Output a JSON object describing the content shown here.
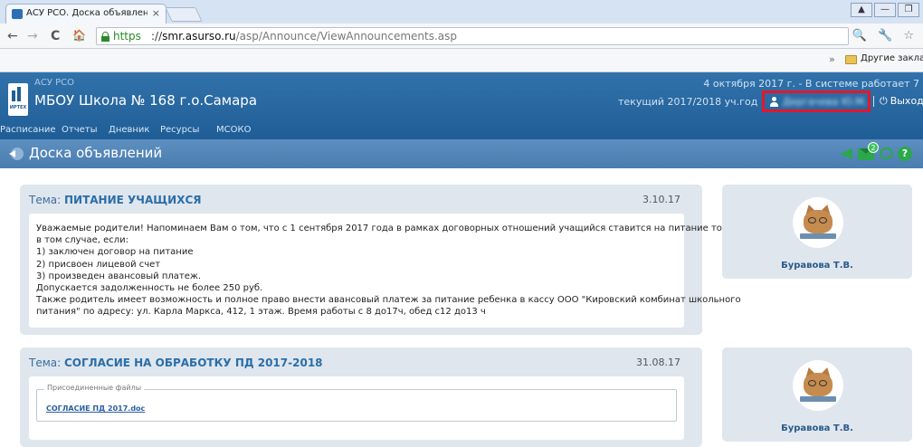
{
  "browser": {
    "tab_title": "АСУ РСО. Доска объявлений",
    "tab_close": "×",
    "window_buttons": [
      "▲",
      "—",
      "❐"
    ],
    "url_scheme": "https",
    "url_separator": "://",
    "url_host": "smr.asurso.ru",
    "url_path": "/asp/Announce/ViewAnnouncements.asp",
    "nav_back": "←",
    "nav_forward": "→",
    "nav_reload": "C",
    "nav_home": "🏠",
    "addr_right_icons": "🔍 🔧 ☆",
    "bookmarks_more": "»",
    "bookmarks_folder": "Другие закладки"
  },
  "header": {
    "system_name": "АСУ РСО",
    "school_name": "МБОУ Школа № 168 г.о.Самара",
    "logo_text": "ИРТЕХ",
    "date_status": "4 октября 2017 г. - В системе работает 7",
    "school_year": "текущий 2017/2018 уч.год",
    "user_name": "Дергачева Ю.М.",
    "logout_label": "Выход",
    "power_glyph": "⏻",
    "nav": [
      "Расписание",
      "Отчеты",
      "Дневник",
      "Ресурсы",
      "МСОКО"
    ]
  },
  "page": {
    "title": "Доска объявлений",
    "unread_count": "2",
    "help_glyph": "?"
  },
  "announcements": [
    {
      "label": "Тема: ",
      "topic": "ПИТАНИЕ УЧАЩИХСЯ",
      "date": "3.10.17",
      "lines": [
        "Уважаемые родители! Напоминаем Вам о том, что с 1 сентября 2017 года в рамках договорных отношений учащийся ставится на питание только",
        "в том случае, если:",
        "1) заключен договор на питание",
        "2) присвоен лицевой счет",
        "3) произведен авансовый платеж.",
        "Допускается задолженность не более 250 руб.",
        "Также родитель имеет возможность и полное право внести авансовый платеж за питание ребенка в кассу ООО \"Кировский комбинат школьного",
        "питания\" по адресу: ул. Карла Маркса, 412, 1 этаж. Время работы с 8 до17ч, обед с12 до13 ч"
      ],
      "author": "Буравова Т.В."
    },
    {
      "label": "Тема: ",
      "topic": "СОГЛАСИЕ НА ОБРАБОТКУ ПД 2017-2018",
      "date": "31.08.17",
      "files_legend": "Присоединенные файлы",
      "file_name": "СОГЛАСИЕ ПД 2017.doc",
      "author": "Буравова Т.В."
    }
  ]
}
